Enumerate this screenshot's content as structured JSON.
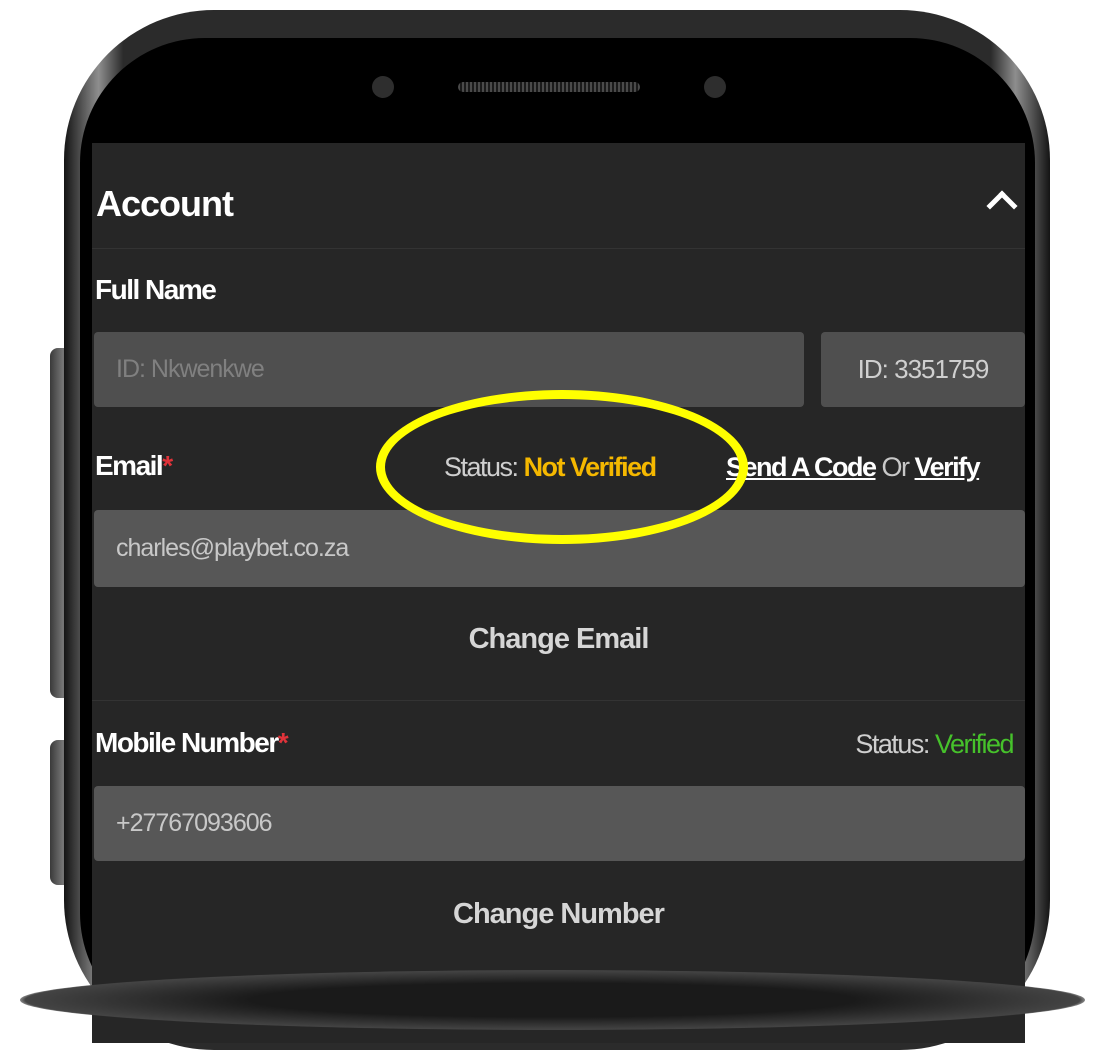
{
  "account": {
    "title": "Account",
    "collapse_icon": "chevron-up-icon",
    "full_name": {
      "label": "Full Name",
      "name_placeholder": "ID: Nkwenkwe",
      "id_value": "ID: 3351759"
    },
    "email": {
      "label": "Email",
      "required_mark": "*",
      "status_prefix": "Status:",
      "status_value": "Not Verified",
      "send_code_label": "Send A Code",
      "or_label": "Or",
      "verify_label": "Verify",
      "value": "charles@playbet.co.za",
      "change_label": "Change Email"
    },
    "mobile": {
      "label": "Mobile Number",
      "required_mark": "*",
      "status_prefix": "Status:",
      "status_value": "Verified",
      "value": "+27767093606",
      "change_label": "Change Number"
    }
  },
  "colors": {
    "screen_bg": "#262626",
    "field_bg": "#4f4f4f",
    "status_warning": "#f5b800",
    "status_ok": "#46c22b",
    "required": "#e0333a",
    "highlight": "#ffff00"
  }
}
